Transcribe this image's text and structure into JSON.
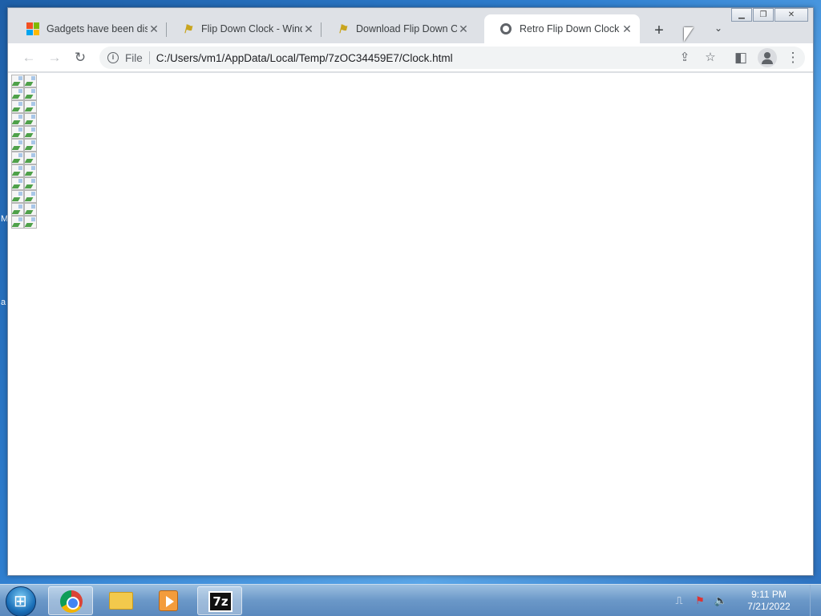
{
  "desktop": {
    "glyph_1": "M",
    "glyph_2": "a"
  },
  "browser": {
    "tabs": [
      {
        "title": "Gadgets have been disc",
        "icon": "microsoft-logo-icon"
      },
      {
        "title": "Flip Down Clock - Winde",
        "icon": "windows-xp-flag-icon"
      },
      {
        "title": "Download Flip Down Cl",
        "icon": "windows-xp-flag-icon"
      },
      {
        "title": "Retro Flip Down Clock",
        "icon": "globe-icon",
        "active": true
      }
    ],
    "new_tab_label": "+",
    "address": {
      "scheme": "File",
      "url": "C:/Users/vm1/AppData/Local/Temp/7zOC34459E7/Clock.html"
    }
  },
  "taskbar": {
    "apps": [
      "chrome-icon",
      "explorer-folder-icon",
      "media-player-icon",
      "7zip-icon"
    ],
    "seven_zip_label": "7z",
    "clock": {
      "time": "9:11 PM",
      "date": "7/21/2022"
    }
  },
  "colors": {
    "tab_active_bg": "#ffffff",
    "tabstrip_bg": "#dee1e6",
    "taskbar": "#6b98c8"
  }
}
